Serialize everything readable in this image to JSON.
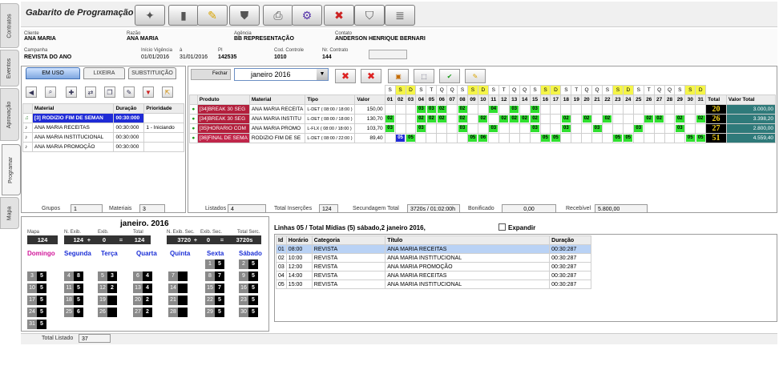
{
  "app": {
    "title": "Gabarito de Programação"
  },
  "side_tabs": [
    "Contratos",
    "Eventos",
    "Aprovação",
    "Programar",
    "Mapa"
  ],
  "info": {
    "cliente_label": "Cliente",
    "cliente": "ANA MARIA",
    "razao_label": "Razão",
    "razao": "ANA MARIA",
    "agencia_label": "Agência",
    "agencia": "BB REPRESENTAÇÃO",
    "contato_label": "Contato",
    "contato": "ANDERSON HENRIQUE BERNARI",
    "campanha_label": "Campanha",
    "campanha": "REVISTA DO ANO",
    "vigencia_label": "Início Vigência",
    "vigencia_a_label": "à",
    "inicio": "01/01/2016",
    "fim": "31/01/2016",
    "pi_label": "PI",
    "pi": "142535",
    "cod_label": "Cod. Controle",
    "cod": "1010",
    "nr_label": "Nr. Contrato",
    "nr": "144"
  },
  "left_tabs": [
    "EM USO",
    "LIXEIRA",
    "SUBSTITUIÇÃO"
  ],
  "materials": {
    "headers": [
      "Material",
      "Duração",
      "Prioridade"
    ],
    "rows": [
      {
        "name": "[3] RODIZIO FIM DE SEMAN",
        "dur": "00:30:000",
        "prio": ""
      },
      {
        "name": "ANA MARIA  RECEITAS",
        "dur": "00:30:000",
        "prio": "1 - Iniciando"
      },
      {
        "name": "ANA MARIA INSTITUCIONAL",
        "dur": "00:30:000",
        "prio": ""
      },
      {
        "name": "ANA MARIA PROMOÇÃO",
        "dur": "00:30:000",
        "prio": ""
      }
    ],
    "grupos_label": "Grupos",
    "grupos": "1",
    "materiais_label": "Materiais",
    "materiais": "3"
  },
  "month": {
    "fechar_label": "Fechar",
    "selected": "janeiro  2016"
  },
  "schedule": {
    "headers": [
      "Produto",
      "Material",
      "Tipo",
      "Valor",
      "Total",
      "Valor Total"
    ],
    "weekday_letters": [
      "S",
      "S",
      "D",
      "S",
      "T",
      "Q",
      "Q",
      "S",
      "S",
      "D",
      "S",
      "T",
      "Q",
      "Q",
      "S",
      "S",
      "D",
      "S",
      "T",
      "Q",
      "Q",
      "S",
      "S",
      "D",
      "S",
      "T",
      "Q",
      "Q",
      "S",
      "S",
      "D"
    ],
    "days": [
      "01",
      "02",
      "03",
      "04",
      "05",
      "06",
      "07",
      "08",
      "09",
      "10",
      "11",
      "12",
      "13",
      "14",
      "15",
      "16",
      "17",
      "18",
      "19",
      "20",
      "21",
      "22",
      "23",
      "24",
      "25",
      "26",
      "27",
      "28",
      "29",
      "30",
      "31"
    ],
    "rows": [
      {
        "produto": "[34]BREAK 30 SEG",
        "material": "ANA MARIA  RECEITA",
        "tipo": "L-DET ( 08:00 / 18:00 )",
        "valor": "150,00",
        "cells": {
          "4": "03",
          "5": "03",
          "6": "02",
          "8": "02",
          "11": "04",
          "13": "03",
          "15": "03"
        },
        "total": "20",
        "valor_total": "3.000,00"
      },
      {
        "produto": "[34]BREAK 30 SEG",
        "material": "ANA MARIA INSTITU",
        "tipo": "L-DET ( 08:00 / 18:00 )",
        "valor": "130,70",
        "cells": {
          "1": "02",
          "4": "02",
          "5": "02",
          "6": "02",
          "8": "02",
          "10": "02",
          "12": "02",
          "13": "02",
          "14": "02",
          "15": "02",
          "18": "02",
          "20": "02",
          "22": "02",
          "26": "02",
          "27": "02",
          "29": "02",
          "31": "02"
        },
        "total": "26",
        "valor_total": "3.398,20"
      },
      {
        "produto": "[35]HORARIO COM",
        "material": "ANA MARIA PROMO",
        "tipo": "L-FLX ( 08:00 / 18:00 )",
        "valor": "103,70",
        "cells": {
          "1": "03",
          "4": "03",
          "8": "03",
          "11": "03",
          "15": "03",
          "18": "03",
          "21": "03",
          "25": "03",
          "29": "03"
        },
        "total": "27",
        "valor_total": "2.800,00"
      },
      {
        "produto": "[36]FINAL DE SEMA",
        "material": "RODIZIO FIM DE SE",
        "tipo": "L-DET ( 08:00 / 22:00 )",
        "valor": "89,40",
        "cells": {
          "2": "05",
          "3": "05",
          "9": "05",
          "10": "06",
          "16": "05",
          "17": "05",
          "23": "05",
          "24": "05",
          "30": "05",
          "31": "05"
        },
        "total": "51",
        "valor_total": "4.559,40"
      }
    ],
    "listados_label": "Listados",
    "listados": "4",
    "insercoes_label": "Total Inserções",
    "insercoes": "124",
    "secundagem_label": "Secundagem Total",
    "secundagem": "3720s / 01:02:00h",
    "bonificado_label": "Bonificado",
    "bonificado": "0,00",
    "recebivel_label": "Recebível",
    "recebivel": "5.800,00"
  },
  "calendar": {
    "title": "janeiro. 2016",
    "mapa_label": "Mapa",
    "mapa": "124",
    "nexib_label": "N. Exib.",
    "nexib": "124",
    "plus1": "+",
    "exib_label": "Exib.",
    "exib": "0",
    "eq1": "=",
    "total_label": "Total",
    "total": "124",
    "nexibsec_label": "N. Exib. Sec.",
    "nexibsec": "3720",
    "plus2": "+",
    "exibsec_label": "Exib. Sec.",
    "exibsec": "0",
    "eq2": "=",
    "totalsec_label": "Total Serc.",
    "totalsec": "3720s",
    "weekdays": [
      "Domingo",
      "Segunda",
      "Terça",
      "Quarta",
      "Quinta",
      "Sexta",
      "Sábado"
    ],
    "cells": [
      {
        "d": "1",
        "v": "5"
      },
      {
        "d": "2",
        "v": "5"
      },
      {
        "d": "3",
        "v": "5"
      },
      {
        "d": "4",
        "v": "8"
      },
      {
        "d": "5",
        "v": "3"
      },
      {
        "d": "6",
        "v": "4"
      },
      {
        "d": "7",
        "v": ""
      },
      {
        "d": "8",
        "v": "7"
      },
      {
        "d": "9",
        "v": "5"
      },
      {
        "d": "10",
        "v": "5"
      },
      {
        "d": "11",
        "v": "5"
      },
      {
        "d": "12",
        "v": "2"
      },
      {
        "d": "13",
        "v": "4"
      },
      {
        "d": "14",
        "v": ""
      },
      {
        "d": "15",
        "v": "7"
      },
      {
        "d": "16",
        "v": "5"
      },
      {
        "d": "17",
        "v": "5"
      },
      {
        "d": "18",
        "v": "5"
      },
      {
        "d": "19",
        "v": ""
      },
      {
        "d": "20",
        "v": "2"
      },
      {
        "d": "21",
        "v": ""
      },
      {
        "d": "22",
        "v": "5"
      },
      {
        "d": "23",
        "v": "5"
      },
      {
        "d": "24",
        "v": "5"
      },
      {
        "d": "25",
        "v": "6"
      },
      {
        "d": "26",
        "v": ""
      },
      {
        "d": "27",
        "v": "2"
      },
      {
        "d": "28",
        "v": ""
      },
      {
        "d": "29",
        "v": "5"
      },
      {
        "d": "30",
        "v": "5"
      },
      {
        "d": "31",
        "v": "5"
      }
    ]
  },
  "lines": {
    "title": "Linhas 05 / Total Mídias (5)  sábado,2  janeiro  2016,",
    "expand_label": "Expandir",
    "headers": [
      "Id",
      "Horário",
      "Categoria",
      "Título",
      "Duração"
    ],
    "rows": [
      {
        "id": "01",
        "hora": "08:00",
        "cat": "REVISTA",
        "titulo": "ANA MARIA  RECEITAS",
        "dur": "00:30:287"
      },
      {
        "id": "02",
        "hora": "10:00",
        "cat": "REVISTA",
        "titulo": "ANA MARIA INSTITUCIONAL",
        "dur": "00:30:287"
      },
      {
        "id": "03",
        "hora": "12:00",
        "cat": "REVISTA",
        "titulo": "ANA MARIA PROMOÇÃO",
        "dur": "00:30:287"
      },
      {
        "id": "04",
        "hora": "14:00",
        "cat": "REVISTA",
        "titulo": "ANA MARIA  RECEITAS",
        "dur": "00:30:287"
      },
      {
        "id": "05",
        "hora": "15:00",
        "cat": "REVISTA",
        "titulo": "ANA MARIA INSTITUCIONAL",
        "dur": "00:30:287"
      }
    ]
  },
  "footer": {
    "total_listado_label": "Total Listado",
    "total_listado": "37"
  }
}
